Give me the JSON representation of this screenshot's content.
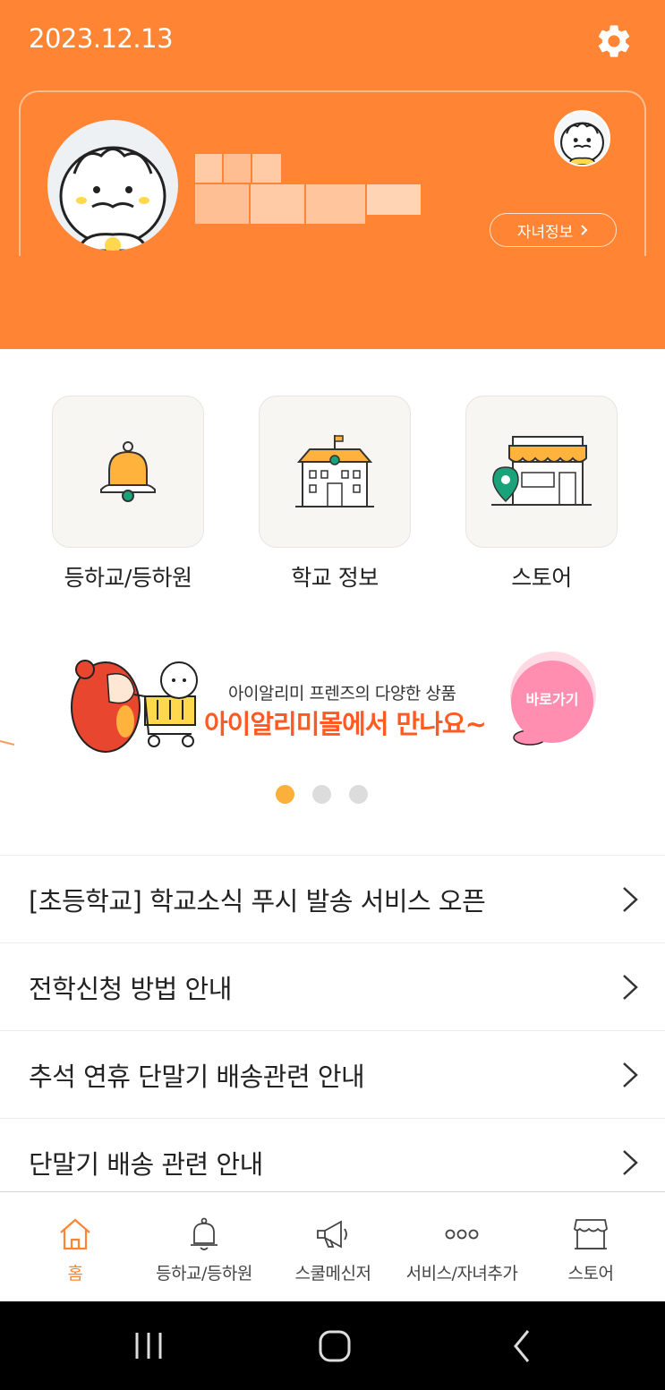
{
  "header": {
    "date": "2023.12.13",
    "settings_icon": "gear-icon"
  },
  "profile": {
    "child_info_label": "자녀정보"
  },
  "quick_menu": [
    {
      "label": "등하교/등하원",
      "icon": "bell-icon"
    },
    {
      "label": "학교 정보",
      "icon": "school-icon"
    },
    {
      "label": "스토어",
      "icon": "store-icon"
    }
  ],
  "banner": {
    "subtitle": "아이알리미 프렌즈의 다양한 상품",
    "title": "아이알리미몰에서 만나요~",
    "button": "바로가기",
    "page_count": 3,
    "active_page": 1
  },
  "notices": [
    "[초등학교] 학교소식 푸시 발송 서비스 오픈",
    "전학신청 방법 안내",
    "추석 연휴 단말기 배송관련 안내",
    "단말기 배송 관련 안내"
  ],
  "bottom_nav": [
    {
      "label": "홈",
      "icon": "home-icon",
      "active": true
    },
    {
      "label": "등하교/등하원",
      "icon": "bell-icon",
      "active": false
    },
    {
      "label": "스쿨메신저",
      "icon": "megaphone-icon",
      "active": false
    },
    {
      "label": "서비스/자녀추가",
      "icon": "more-icon",
      "active": false
    },
    {
      "label": "스토어",
      "icon": "store-icon",
      "active": false
    }
  ],
  "colors": {
    "brand_orange": "#ff8534",
    "banner_red": "#ff5a22",
    "dot_active": "#fbb03b"
  }
}
